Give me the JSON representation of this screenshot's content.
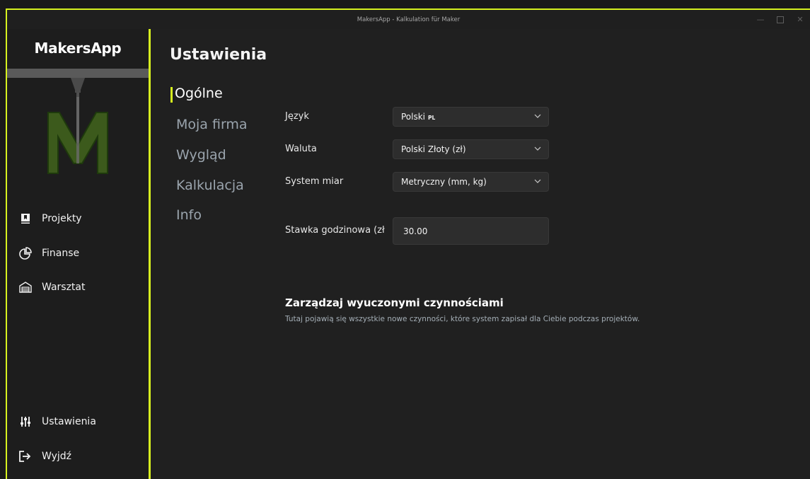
{
  "window": {
    "title": "MakersApp - Kalkulation für Maker",
    "accent_color": "#d7f21f",
    "controls": [
      "minimize-icon",
      "maximize-icon",
      "close-icon"
    ]
  },
  "sidebar": {
    "brand": "MakersApp",
    "logo_letter": "M",
    "items": [
      {
        "label": "Projekty",
        "icon": "projects-icon"
      },
      {
        "label": "Finanse",
        "icon": "pie-chart-icon"
      },
      {
        "label": "Warsztat",
        "icon": "workshop-icon"
      }
    ],
    "bottom_items": [
      {
        "label": "Ustawienia",
        "icon": "sliders-icon"
      },
      {
        "label": "Wyjdź",
        "icon": "exit-icon"
      }
    ]
  },
  "main": {
    "title": "Ustawienia",
    "subnav": [
      {
        "label": "Ogólne",
        "active": true
      },
      {
        "label": "Moja firma"
      },
      {
        "label": "Wygląd"
      },
      {
        "label": "Kalkulacja"
      },
      {
        "label": "Info"
      }
    ],
    "settings": {
      "language": {
        "label": "Język",
        "value": "Polski",
        "tag": "PL"
      },
      "currency": {
        "label": "Waluta",
        "value": "Polski Złoty (zł)"
      },
      "units": {
        "label": "System miar",
        "value": "Metryczny (mm, kg)"
      },
      "hourly_rate": {
        "label": "Stawka godzinowa (zł",
        "value": "30.00"
      }
    },
    "activities": {
      "title": "Zarządzaj wyuczonymi czynnościami",
      "description": "Tutaj pojawią się wszystkie nowe czynności, które system zapisał dla Ciebie podczas projektów."
    }
  }
}
